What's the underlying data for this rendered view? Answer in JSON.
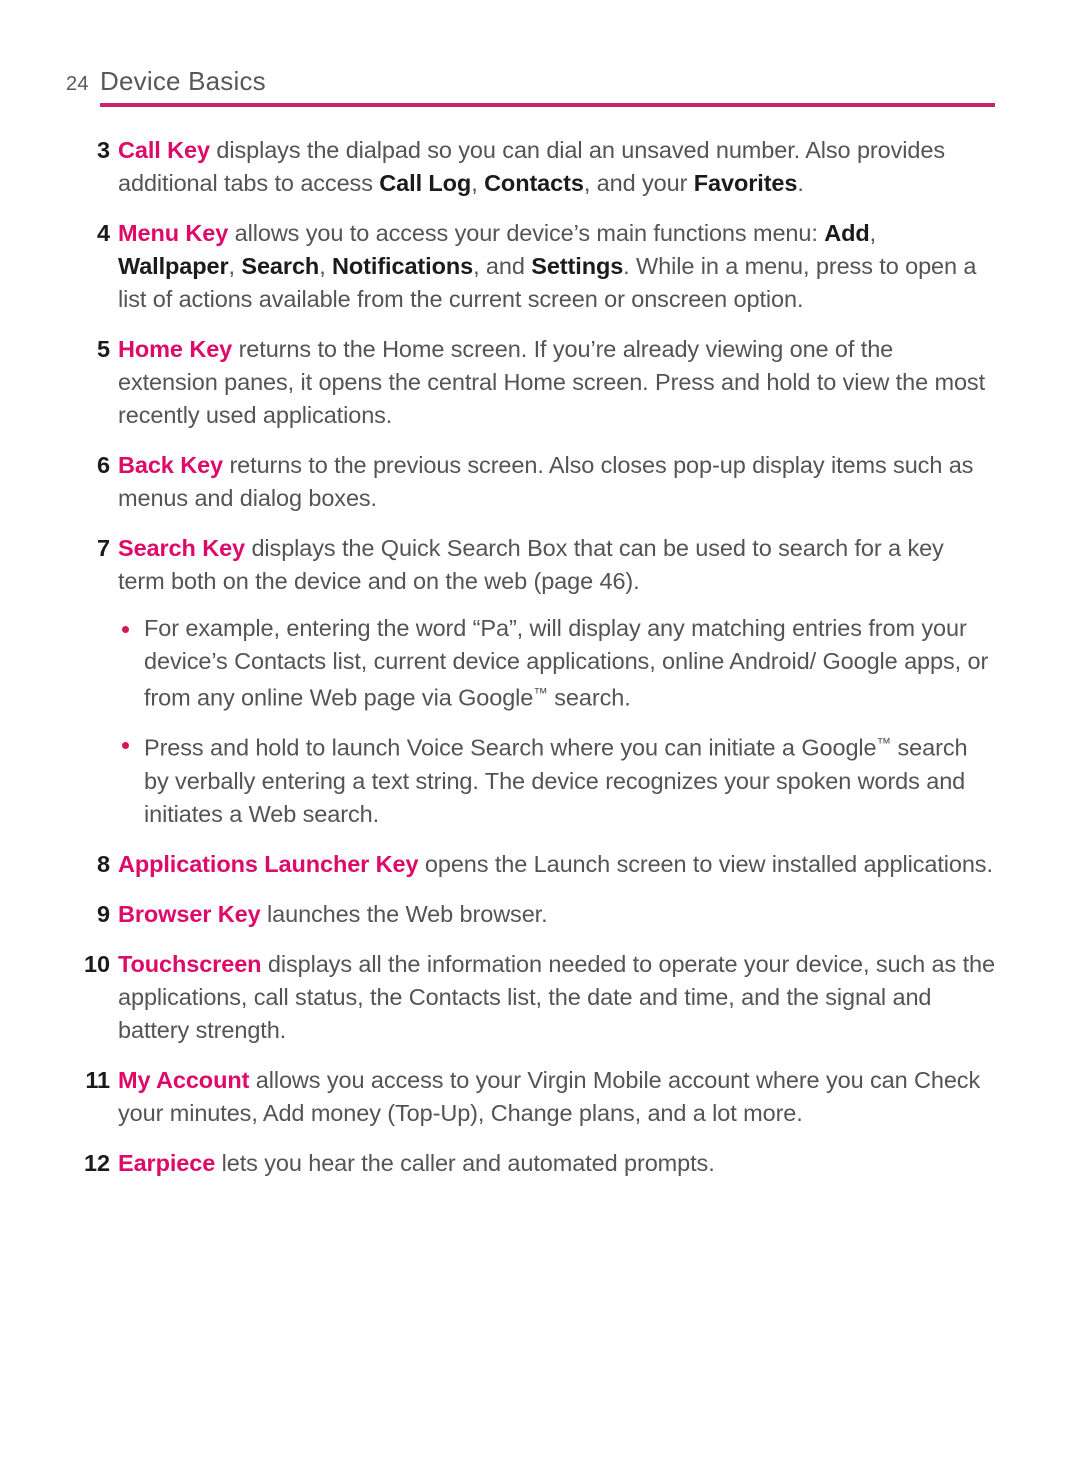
{
  "page": {
    "number": "24",
    "section_title": "Device Basics",
    "rule_color": "#c6266a",
    "term_color": "#de0a6a",
    "body_color": "#545456"
  },
  "items": [
    {
      "num": "3",
      "term": "Call Key",
      "segments": [
        {
          "type": "text",
          "text": " displays the dialpad so you can dial an unsaved number. Also provides additional tabs to access "
        },
        {
          "type": "bold",
          "text": "Call Log"
        },
        {
          "type": "text",
          "text": ", "
        },
        {
          "type": "bold",
          "text": "Contacts"
        },
        {
          "type": "text",
          "text": ", and your "
        },
        {
          "type": "bold",
          "text": "Favorites"
        },
        {
          "type": "text",
          "text": "."
        }
      ]
    },
    {
      "num": "4",
      "term": "Menu Key",
      "segments": [
        {
          "type": "text",
          "text": " allows you to access your device’s main functions menu: "
        },
        {
          "type": "bold",
          "text": "Add"
        },
        {
          "type": "text",
          "text": ", "
        },
        {
          "type": "bold",
          "text": "Wallpaper"
        },
        {
          "type": "text",
          "text": ", "
        },
        {
          "type": "bold",
          "text": "Search"
        },
        {
          "type": "text",
          "text": ", "
        },
        {
          "type": "bold",
          "text": "Notifications"
        },
        {
          "type": "text",
          "text": ", and "
        },
        {
          "type": "bold",
          "text": "Settings"
        },
        {
          "type": "text",
          "text": ". While in a menu, press to open a list of actions available from the current screen or onscreen option."
        }
      ]
    },
    {
      "num": "5",
      "term": "Home Key",
      "segments": [
        {
          "type": "text",
          "text": " returns to the Home screen. If you’re already viewing one of the extension panes, it opens the central Home screen. Press and hold to view the most recently used applications."
        }
      ]
    },
    {
      "num": "6",
      "term": "Back Key",
      "segments": [
        {
          "type": "text",
          "text": " returns to the previous screen. Also closes pop-up display items such as menus and dialog boxes."
        }
      ]
    },
    {
      "num": "7",
      "term": "Search Key",
      "segments": [
        {
          "type": "text",
          "text": " displays the Quick Search Box that can be used to search for a key term both on the device and on the web (page 46)."
        }
      ],
      "bullets": [
        {
          "segments": [
            {
              "type": "text",
              "text": "For example, entering the word “Pa”, will display any matching entries from your device’s Contacts list, current device applications, online Android/ Google apps, or from any online Web page via Google"
            },
            {
              "type": "tm",
              "text": "™"
            },
            {
              "type": "text",
              "text": " search."
            }
          ]
        },
        {
          "segments": [
            {
              "type": "text",
              "text": "Press and hold to launch Voice Search where you can initiate a Google"
            },
            {
              "type": "tm",
              "text": "™"
            },
            {
              "type": "text",
              "text": " search by verbally entering a text string. The device recognizes your spoken words and initiates a Web search."
            }
          ]
        }
      ]
    },
    {
      "num": "8",
      "term": "Applications Launcher Key",
      "segments": [
        {
          "type": "text",
          "text": " opens the Launch screen to view installed applications."
        }
      ]
    },
    {
      "num": "9",
      "term": "Browser Key",
      "segments": [
        {
          "type": "text",
          "text": " launches the Web browser."
        }
      ]
    },
    {
      "num": "10",
      "term": "Touchscreen",
      "segments": [
        {
          "type": "text",
          "text": " displays all the information needed to operate your device, such as the applications, call status, the Contacts list, the date and time, and the signal and battery strength."
        }
      ]
    },
    {
      "num": "11",
      "term": "My Account",
      "segments": [
        {
          "type": "text",
          "text": " allows you access to your Virgin Mobile account where you can Check your minutes, Add money (Top-Up), Change plans, and a lot more."
        }
      ]
    },
    {
      "num": "12",
      "term": "Earpiece",
      "segments": [
        {
          "type": "text",
          "text": " lets you hear the caller and automated prompts."
        }
      ]
    }
  ]
}
